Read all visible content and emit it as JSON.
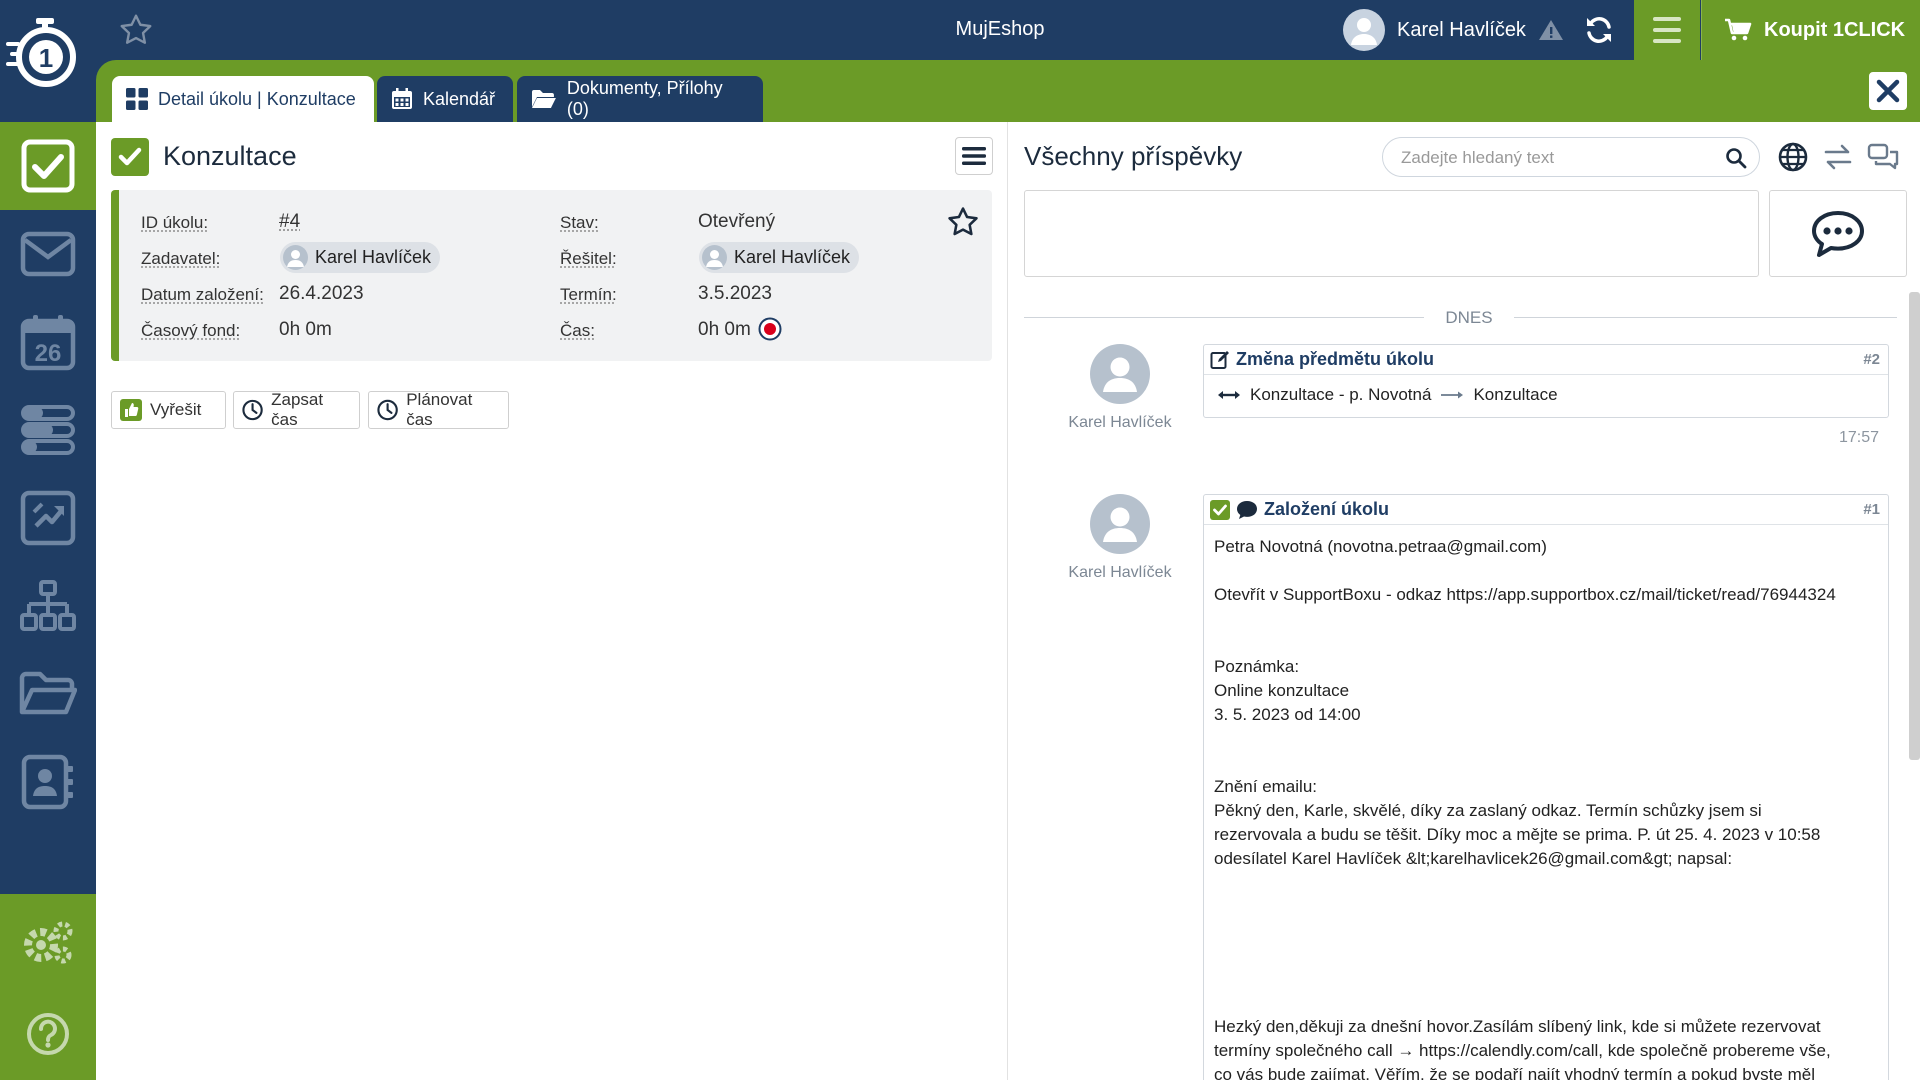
{
  "topbar": {
    "app_title": "MujEshop",
    "user_name": "Karel Havlíček",
    "buy_label": "Koupit 1CLICK"
  },
  "sidebar": {
    "items": [
      "tasks-icon",
      "mail-icon",
      "calendar-26-icon",
      "servers-icon",
      "workflow-icon",
      "org-chart-icon",
      "folder-icon",
      "contacts-icon"
    ],
    "calendar_day": "26",
    "bottom": [
      "settings-icon",
      "help-icon"
    ]
  },
  "tabs": [
    {
      "label": "Detail úkolu | Konzultace",
      "active": true,
      "icon": "grid-icon"
    },
    {
      "label": "Kalendář",
      "active": false,
      "icon": "calendar-icon"
    },
    {
      "label": "Dokumenty, Přílohy (0)",
      "active": false,
      "icon": "folder-open-icon"
    }
  ],
  "task": {
    "title": "Konzultace",
    "fields": {
      "id_label": "ID úkolu:",
      "id_value": "#4",
      "zadavatel_label": "Zadavatel:",
      "zadavatel_value": "Karel Havlíček",
      "datum_label": "Datum založení:",
      "datum_value": "26.4.2023",
      "fond_label": "Časový fond:",
      "fond_value": "0h 0m",
      "stav_label": "Stav:",
      "stav_value": "Otevřený",
      "resitel_label": "Řešitel:",
      "resitel_value": "Karel Havlíček",
      "termin_label": "Termín:",
      "termin_value": "3.5.2023",
      "cas_label": "Čas:",
      "cas_value": "0h 0m"
    },
    "actions": [
      "Vyřešit",
      "Zapsat čas",
      "Plánovat čas"
    ]
  },
  "posts_panel": {
    "title": "Všechny příspěvky",
    "search_placeholder": "Zadejte hledaný text",
    "day_label": "DNES",
    "posts": [
      {
        "author": "Karel Havlíček",
        "title": "Změna předmětu úkolu",
        "number": "#2",
        "from": "Konzultace - p. Novotná",
        "to": "Konzultace",
        "time": "17:57"
      },
      {
        "author": "Karel Havlíček",
        "title": "Založení úkolu",
        "number": "#1",
        "body": "Petra Novotná (novotna.petraa@gmail.com)\n\nOtevřít v SupportBoxu - odkaz https://app.supportbox.cz/mail/ticket/read/76944324\n\n\nPoznámka:\nOnline konzultace\n3. 5. 2023 od 14:00\n\n\nZnění emailu:\nPěkný den, Karle, skvělé, díky za zaslaný odkaz. Termín schůzky jsem si\nrezervovala a budu se těšit. Díky moc a mějte se prima. P. út 25. 4. 2023 v 10:58\nodesílatel Karel Havlíček &lt;karelhavlicek26@gmail.com&gt; napsal:\n\n\n\n\n\n\nHezký den,děkuji za dnešní hovor.Zasílám slíbený link, kde si můžete rezervovat\ntermíny společného call → https://calendly.com/call, kde společně probereme vše,\nco vás bude zajímat. Věřím, že se podaří najít vhodný termín a pokud byste měl"
      }
    ]
  },
  "colors": {
    "navy": "#1f3d64",
    "green": "#6b9b27",
    "record_red": "#d9001b"
  }
}
